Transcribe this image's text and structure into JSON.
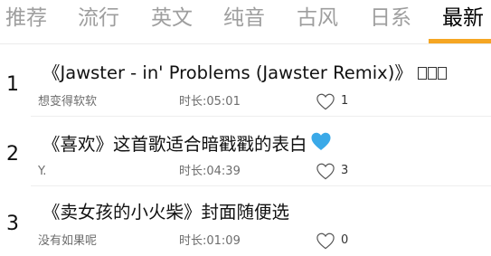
{
  "tabs": [
    {
      "label": "推荐",
      "active": false
    },
    {
      "label": "流行",
      "active": false
    },
    {
      "label": "英文",
      "active": false
    },
    {
      "label": "纯音",
      "active": false
    },
    {
      "label": "古风",
      "active": false
    },
    {
      "label": "日系",
      "active": false
    },
    {
      "label": "最新",
      "active": true
    }
  ],
  "colors": {
    "accent": "#f5a623",
    "heart_emoji": "#3aa9e8"
  },
  "songs": [
    {
      "rank": "1",
      "title": "《Jawster - in' Problems (Jawster Remix)》",
      "author": "想变得软软",
      "duration": "时长:05:01",
      "likes": "1",
      "title_badge_icon": "missing-glyph-boxes"
    },
    {
      "rank": "2",
      "title": "《喜欢》这首歌适合暗戳戳的表白",
      "author": "Y.",
      "duration": "时长:04:39",
      "likes": "3",
      "title_badge_icon": "blue-heart-emoji"
    },
    {
      "rank": "3",
      "title": "《卖女孩的小火柴》封面随便选",
      "author": "没有如果呢",
      "duration": "时长:01:09",
      "likes": "0"
    }
  ]
}
